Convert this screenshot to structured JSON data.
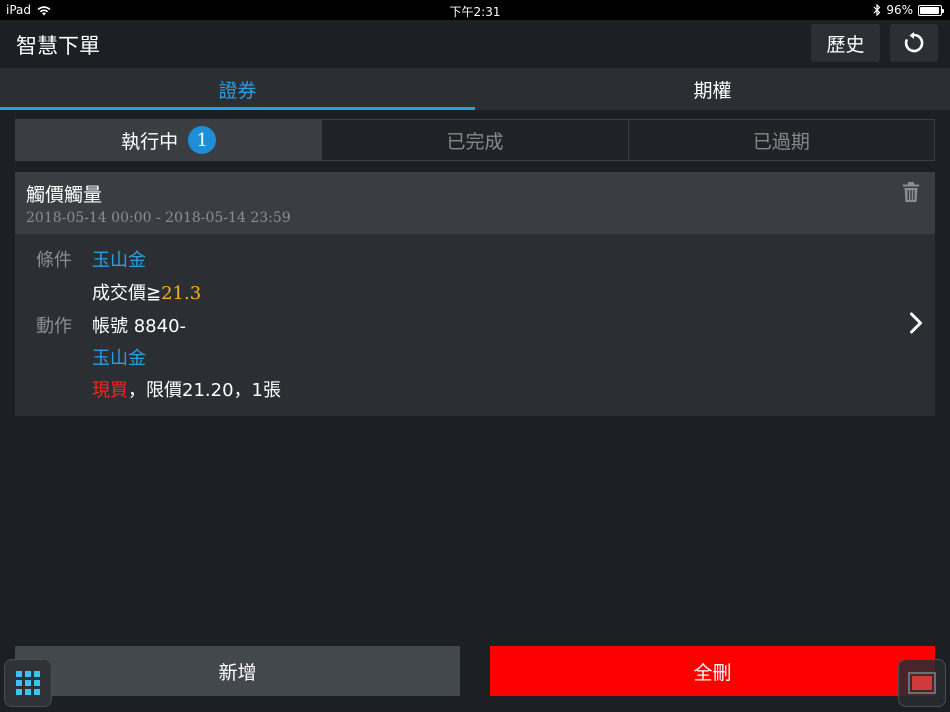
{
  "status_bar": {
    "device": "iPad",
    "time": "下午2:31",
    "battery": "96%",
    "battery_level": 0.96
  },
  "header": {
    "title": "智慧下單",
    "history_label": "歷史"
  },
  "tabs": [
    {
      "label": "證券",
      "active": true
    },
    {
      "label": "期權",
      "active": false
    }
  ],
  "segments": [
    {
      "label": "執行中",
      "badge": "1",
      "active": true
    },
    {
      "label": "已完成",
      "active": false
    },
    {
      "label": "已過期",
      "active": false
    }
  ],
  "order": {
    "title": "觸價觸量",
    "time_range": "2018-05-14 00:00 - 2018-05-14 23:59",
    "condition_label": "條件",
    "condition_stock": "玉山金",
    "condition_text": "成交價≧",
    "condition_value": "21.3",
    "action_label": "動作",
    "account_text": "帳號 8840-",
    "action_stock": "玉山金",
    "order_type": "現買",
    "order_detail": "，限價21.20，1張"
  },
  "bottom": {
    "add_label": "新增",
    "delete_all_label": "全刪"
  },
  "colors": {
    "accent": "#2a9fe0",
    "price": "#f2b61a",
    "buy": "#ff2020",
    "delete": "#ff0000"
  }
}
